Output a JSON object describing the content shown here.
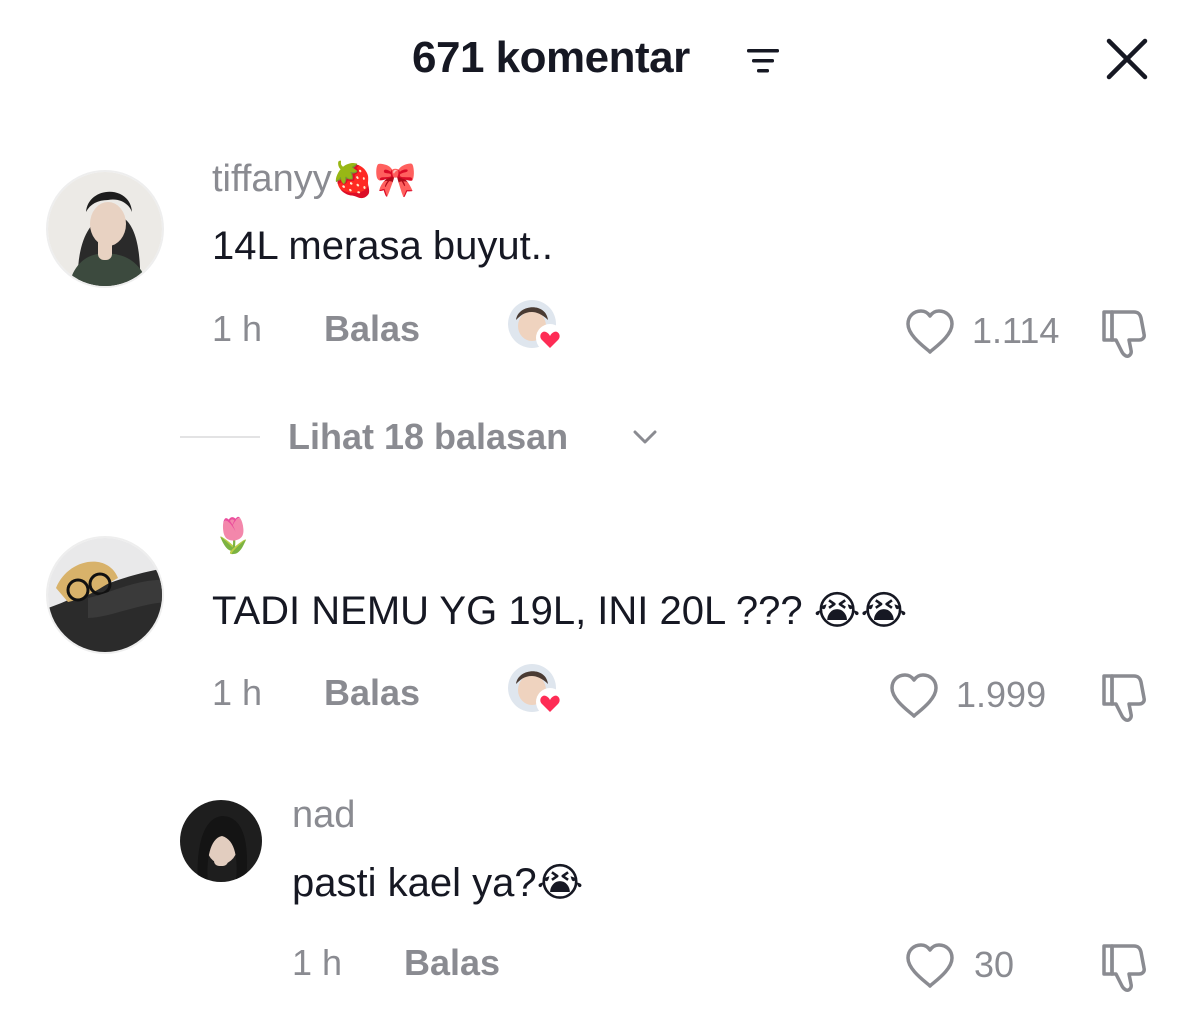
{
  "header": {
    "title": "671 komentar",
    "filter_icon": "filter-sort-icon",
    "close_icon": "close-icon"
  },
  "comments": [
    {
      "username": "tiffanyy",
      "username_emoji": "🍓🎀",
      "text": "14L merasa buyut..",
      "time": "1 h",
      "reply_label": "Balas",
      "likes": "1.114",
      "creator_liked": true,
      "replies_label": "Lihat 18 balasan"
    },
    {
      "username": "",
      "username_emoji": "🌷",
      "text": "TADI NEMU YG 19L, INI 20L ??? 😭😭",
      "time": "1 h",
      "reply_label": "Balas",
      "likes": "1.999",
      "creator_liked": true
    },
    {
      "username": "nad",
      "text": "pasti kael ya?😭",
      "time": "1 h",
      "reply_label": "Balas",
      "likes": "30",
      "creator_liked": false,
      "is_reply": true
    }
  ],
  "colors": {
    "primary_text": "#161823",
    "secondary_text": "#8a8b91",
    "divider": "#e3e3e4",
    "heart_badge": "#fe2c55"
  }
}
